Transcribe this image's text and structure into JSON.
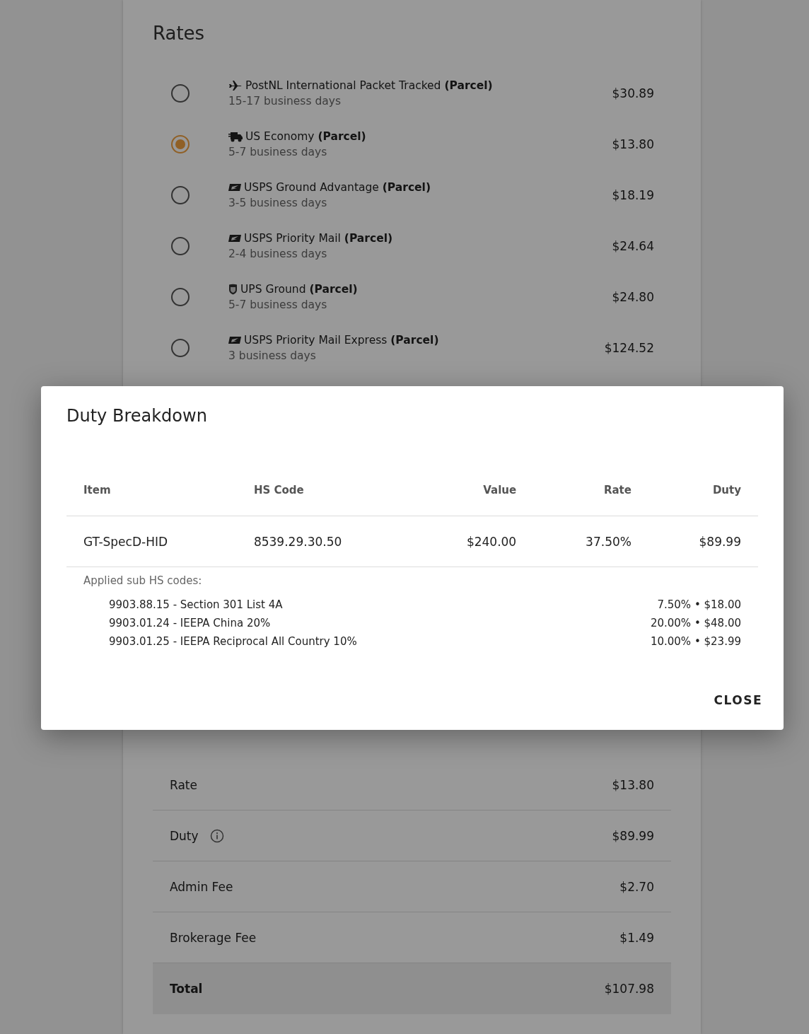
{
  "rates": {
    "title": "Rates",
    "options": [
      {
        "kind": "plane",
        "name": "PostNL International Packet Tracked **(Parcel)**",
        "days": "15-17 business days",
        "price": "$30.89",
        "selected": false
      },
      {
        "kind": "truck",
        "name": "US Economy **(Parcel)**",
        "days": "5-7 business days",
        "price": "$13.80",
        "selected": true
      },
      {
        "kind": "usps",
        "name": "USPS Ground Advantage **(Parcel)**",
        "days": "3-5 business days",
        "price": "$18.19",
        "selected": false
      },
      {
        "kind": "usps",
        "name": "USPS Priority Mail **(Parcel)**",
        "days": "2-4 business days",
        "price": "$24.64",
        "selected": false
      },
      {
        "kind": "ups",
        "name": "UPS Ground **(Parcel)**",
        "days": "5-7 business days",
        "price": "$24.80",
        "selected": false
      },
      {
        "kind": "usps",
        "name": "USPS Priority Mail Express **(Parcel)**",
        "days": "3 business days",
        "price": "$124.52",
        "selected": false
      }
    ]
  },
  "summary": {
    "rows": [
      {
        "label": "Rate",
        "value": "$13.80",
        "info": false,
        "total": false
      },
      {
        "label": "Duty",
        "value": "$89.99",
        "info": true,
        "total": false
      },
      {
        "label": "Admin Fee",
        "value": "$2.70",
        "info": false,
        "total": false
      },
      {
        "label": "Brokerage Fee",
        "value": "$1.49",
        "info": false,
        "total": false
      },
      {
        "label": "Total",
        "value": "$107.98",
        "info": false,
        "total": true
      }
    ]
  },
  "dialog": {
    "title": "Duty Breakdown",
    "columns": [
      "Item",
      "HS Code",
      "Value",
      "Rate",
      "Duty"
    ],
    "rows": [
      {
        "cells": [
          "GT-SpecD-HID",
          "8539.29.30.50",
          "$240.00",
          "37.50%",
          "$89.99"
        ]
      }
    ],
    "sub_heading": "Applied sub HS codes:",
    "sub_codes": [
      {
        "code": "9903.88.15 - Section 301 List 4A",
        "amount": "7.50% • $18.00"
      },
      {
        "code": "9903.01.24 - IEEPA China 20%",
        "amount": "20.00% • $48.00"
      },
      {
        "code": "9903.01.25 - IEEPA Reciprocal All Country 10%",
        "amount": "10.00% • $23.99"
      }
    ],
    "button": "CLOSE"
  }
}
